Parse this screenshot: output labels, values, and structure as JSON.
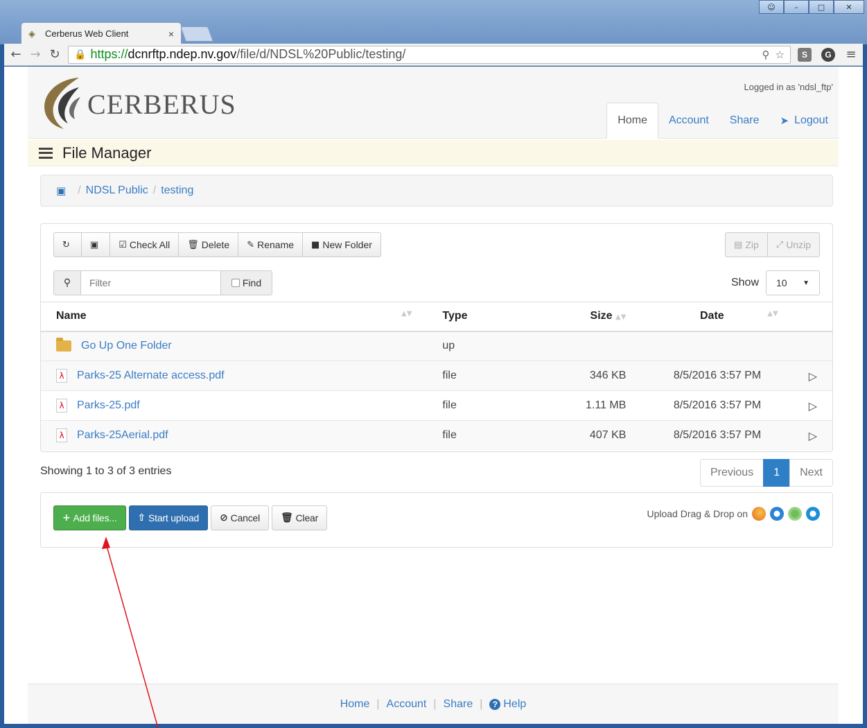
{
  "browser": {
    "tab_title": "Cerberus Web Client",
    "url_scheme": "https://",
    "url_host": "dcnrftp.ndep.nv.gov",
    "url_path": "/file/d/NDSL%20Public/testing/"
  },
  "header": {
    "logo_text": "CERBERUS",
    "logged_in": "Logged in as 'ndsl_ftp'",
    "nav": [
      "Home",
      "Account",
      "Share",
      "Logout"
    ]
  },
  "file_manager": {
    "title": "File Manager",
    "breadcrumb": [
      "NDSL Public",
      "testing"
    ]
  },
  "toolbar": {
    "check_all": "Check All",
    "delete": "Delete",
    "rename": "Rename",
    "new_folder": "New Folder",
    "zip": "Zip",
    "unzip": "Unzip",
    "filter_placeholder": "Filter",
    "find": "Find",
    "show_label": "Show",
    "show_value": "10"
  },
  "table": {
    "headers": [
      "Name",
      "Type",
      "Size",
      "Date"
    ],
    "rows": [
      {
        "name": "Go Up One Folder",
        "type": "up",
        "size": "",
        "date": ""
      },
      {
        "name": "Parks-25 Alternate access.pdf",
        "type": "file",
        "size": "346 KB",
        "date": "8/5/2016 3:57 PM"
      },
      {
        "name": "Parks-25.pdf",
        "type": "file",
        "size": "1.11 MB",
        "date": "8/5/2016 3:57 PM"
      },
      {
        "name": "Parks-25Aerial.pdf",
        "type": "file",
        "size": "407 KB",
        "date": "8/5/2016 3:57 PM"
      }
    ]
  },
  "pagination": {
    "showing": "Showing 1 to 3 of 3 entries",
    "previous": "Previous",
    "current": "1",
    "next": "Next"
  },
  "upload": {
    "add_files": "Add files...",
    "start_upload": "Start upload",
    "cancel": "Cancel",
    "clear": "Clear",
    "drag_drop": "Upload Drag & Drop on"
  },
  "footer": {
    "home": "Home",
    "account": "Account",
    "share": "Share",
    "help": "Help"
  },
  "colors": {
    "link": "#3a7cc4",
    "green": "#4cae4c",
    "blue": "#2f6fb0",
    "annotation_arrow": "#e0141e"
  }
}
